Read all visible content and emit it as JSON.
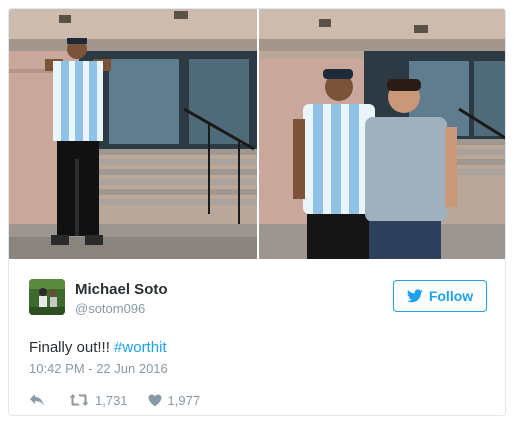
{
  "tweet": {
    "author_name": "Michael Soto",
    "author_handle": "@sotom096",
    "follow_label": "Follow",
    "text_plain": "Finally out!!! ",
    "hashtag": "#worthit",
    "timestamp": "10:42 PM - 22 Jun 2016",
    "retweet_count": "1,731",
    "like_count": "1,977"
  },
  "colors": {
    "brand_blue": "#1da1f2",
    "text_primary": "#292f33",
    "text_secondary": "#8899a6",
    "border": "#e1e8ed"
  },
  "icons": {
    "follow": "twitter-bird-icon",
    "reply": "reply-arrow-icon",
    "retweet": "retweet-icon",
    "like": "heart-icon"
  }
}
